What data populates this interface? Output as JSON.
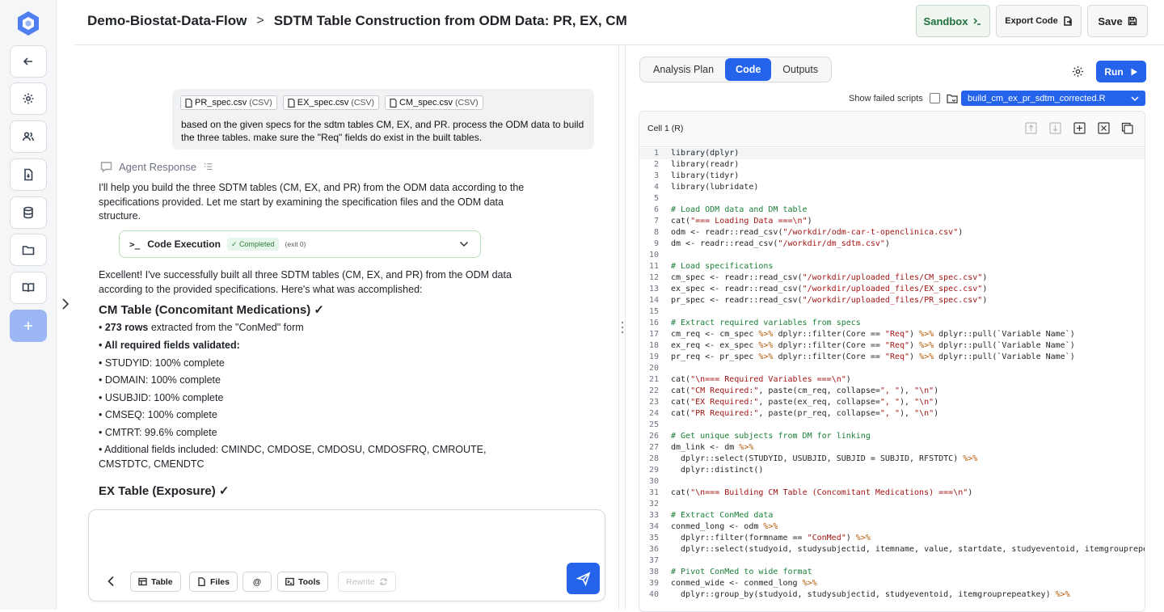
{
  "header": {
    "project": "Demo-Biostat-Data-Flow",
    "separator": ">",
    "title": "SDTM Table Construction from ODM Data: PR, EX, CM",
    "sandbox_label": "Sandbox",
    "export_label": "Export Code",
    "save_label": "Save"
  },
  "colors": {
    "accent": "#2563eb",
    "success": "#2e7d3a"
  },
  "rail_icons": [
    "back-arrow-icon",
    "gear-icon",
    "users-icon",
    "document-icon",
    "database-icon",
    "folder-icon",
    "book-icon",
    "plus-icon"
  ],
  "chat": {
    "attachments": [
      {
        "name": "PR_spec.csv",
        "type": "(CSV)"
      },
      {
        "name": "EX_spec.csv",
        "type": "(CSV)"
      },
      {
        "name": "CM_spec.csv",
        "type": "(CSV)"
      }
    ],
    "user_message": "based on the given specs for the sdtm tables CM, EX, and PR. process the ODM data to build the three tables. make sure the \"Req\" fields do exist in the built tables.",
    "agent_label": "Agent Response",
    "intro": "I'll help you build the three SDTM tables (CM, EX, and PR) from the ODM data according to the specifications provided. Let me start by examining the specification files and the ODM data structure.",
    "exec": {
      "prompt": ">_",
      "label": "Code Execution",
      "status": "✓ Completed",
      "exit": "(exit 0)"
    },
    "summary": "Excellent! I've successfully built all three SDTM tables (CM, EX, and PR) from the ODM data according to the provided specifications. Here's what was accomplished:",
    "cm_heading": "CM Table (Concomitant Medications) ✓",
    "cm_rows_bold": "273 rows",
    "cm_rows_rest": " extracted from the \"ConMed\" form",
    "cm_validated": "All required fields validated:",
    "cm_fields": [
      "• STUDYID: 100% complete",
      "• DOMAIN: 100% complete",
      "• USUBJID: 100% complete",
      "• CMSEQ: 100% complete",
      "• CMTRT: 99.6% complete",
      "• Additional fields included: CMINDC, CMDOSE, CMDOSU, CMDOSFRQ, CMROUTE, CMSTDTC, CMENDTC"
    ],
    "ex_heading": "EX Table (Exposure) ✓",
    "composer": {
      "table": "Table",
      "files": "Files",
      "mention": "@",
      "tools": "Tools",
      "rewrite": "Rewrite"
    }
  },
  "panel": {
    "tabs": [
      "Analysis Plan",
      "Code",
      "Outputs"
    ],
    "active_tab": "Code",
    "run_label": "Run",
    "show_failed": "Show failed scripts",
    "script": "build_cm_ex_pr_sdtm_corrected.R",
    "cell_title": "Cell 1 (R)"
  },
  "code_lines": [
    "library(dplyr)",
    "library(readr)",
    "library(tidyr)",
    "library(lubridate)",
    "",
    "# Load ODM data and DM table",
    "cat(\"=== Loading Data ===\\n\")",
    "odm <- readr::read_csv(\"/workdir/odm-car-t-openclinica.csv\")",
    "dm <- readr::read_csv(\"/workdir/dm_sdtm.csv\")",
    "",
    "# Load specifications",
    "cm_spec <- readr::read_csv(\"/workdir/uploaded_files/CM_spec.csv\")",
    "ex_spec <- readr::read_csv(\"/workdir/uploaded_files/EX_spec.csv\")",
    "pr_spec <- readr::read_csv(\"/workdir/uploaded_files/PR_spec.csv\")",
    "",
    "# Extract required variables from specs",
    "cm_req <- cm_spec %>% dplyr::filter(Core == \"Req\") %>% dplyr::pull(`Variable Name`)",
    "ex_req <- ex_spec %>% dplyr::filter(Core == \"Req\") %>% dplyr::pull(`Variable Name`)",
    "pr_req <- pr_spec %>% dplyr::filter(Core == \"Req\") %>% dplyr::pull(`Variable Name`)",
    "",
    "cat(\"\\n=== Required Variables ===\\n\")",
    "cat(\"CM Required:\", paste(cm_req, collapse=\", \"), \"\\n\")",
    "cat(\"EX Required:\", paste(ex_req, collapse=\", \"), \"\\n\")",
    "cat(\"PR Required:\", paste(pr_req, collapse=\", \"), \"\\n\")",
    "",
    "# Get unique subjects from DM for linking",
    "dm_link <- dm %>%",
    "  dplyr::select(STUDYID, USUBJID, SUBJID = SUBJID, RFSTDTC) %>%",
    "  dplyr::distinct()",
    "",
    "cat(\"\\n=== Building CM Table (Concomitant Medications) ===\\n\")",
    "",
    "# Extract ConMed data",
    "conmed_long <- odm %>%",
    "  dplyr::filter(formname == \"ConMed\") %>%",
    "  dplyr::select(studyoid, studysubjectid, itemname, value, startdate, studyeventoid, itemgrouprepeatkey)",
    "",
    "# Pivot ConMed to wide format",
    "conmed_wide <- conmed_long %>%",
    "  dplyr::group_by(studyoid, studysubjectid, studyeventoid, itemgrouprepeatkey) %>%"
  ]
}
